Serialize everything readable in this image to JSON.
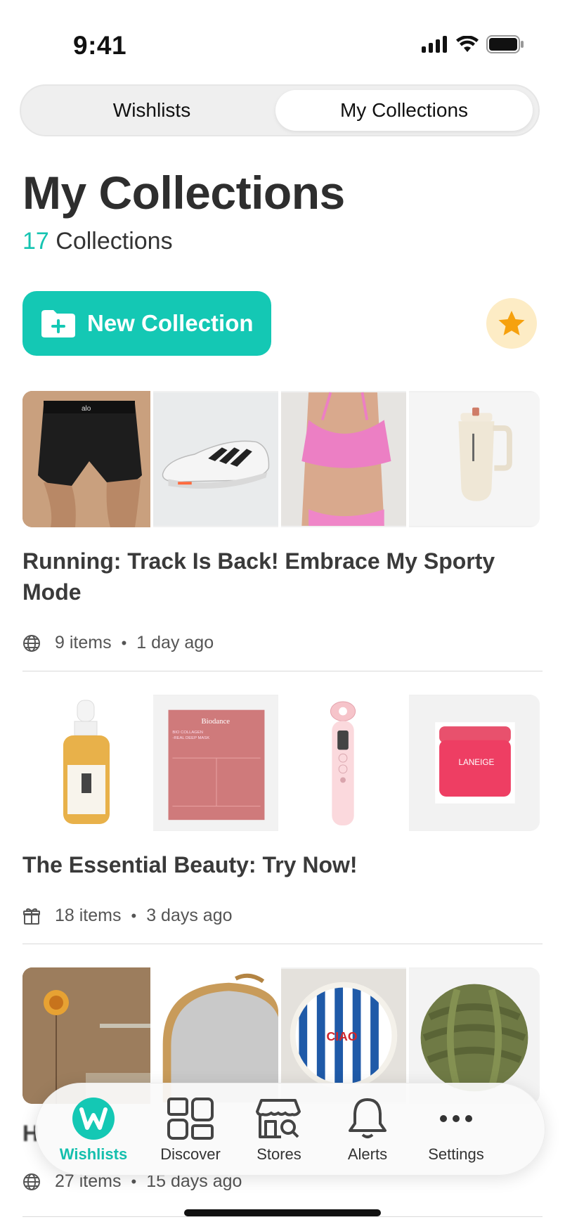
{
  "status_bar": {
    "time": "9:41"
  },
  "segmented_control": {
    "left_label": "Wishlists",
    "right_label": "My Collections",
    "selected": "My Collections"
  },
  "header": {
    "title": "My Collections",
    "count_number": "17",
    "count_label": "Collections"
  },
  "new_collection_button": {
    "label": "New Collection",
    "icon": "folder-plus-icon"
  },
  "favorites_button": {
    "icon": "star-icon",
    "color": "#f6a10e"
  },
  "collections": [
    {
      "title": "Running: Track Is Back! Embrace My Sporty Mode",
      "visibility_icon": "globe-icon",
      "items": "9 items",
      "updated": "1 day ago",
      "thumbnails": [
        "black-shorts",
        "white-running-shoe",
        "pink-sports-bra",
        "cream-tumbler"
      ]
    },
    {
      "title": "The Essential Beauty: Try Now!",
      "visibility_icon": "gift-icon",
      "items": "18 items",
      "updated": "3 days ago",
      "thumbnails": [
        "serum-bottle",
        "sheet-mask",
        "facial-device",
        "lip-mask-jar"
      ]
    },
    {
      "title": "H",
      "visibility_icon": "globe-icon",
      "items": "27 items",
      "updated": "15 days ago",
      "thumbnails": [
        "wall-lamp-room",
        "arched-gold-mirror",
        "striped-ceramic-plate",
        "knot-cushion"
      ]
    }
  ],
  "thumbnail_texts": {
    "brand_shorts": "alo",
    "mask_brand": "Biodance",
    "mask_line1": "BIO COLLAGEN",
    "mask_line2": "-REAL DEEP MASK",
    "jar_brand": "LANEIGE",
    "plate_text": "CIAO"
  },
  "tab_bar": {
    "tabs": [
      {
        "label": "Wishlists",
        "icon": "wishlists-logo-icon",
        "active": true
      },
      {
        "label": "Discover",
        "icon": "discover-grid-icon",
        "active": false
      },
      {
        "label": "Stores",
        "icon": "store-icon",
        "active": false
      },
      {
        "label": "Alerts",
        "icon": "bell-icon",
        "active": false
      },
      {
        "label": "Settings",
        "icon": "more-dots-icon",
        "active": false
      }
    ]
  },
  "colors": {
    "accent": "#14c8b4",
    "star_bg": "#fdecc5"
  }
}
